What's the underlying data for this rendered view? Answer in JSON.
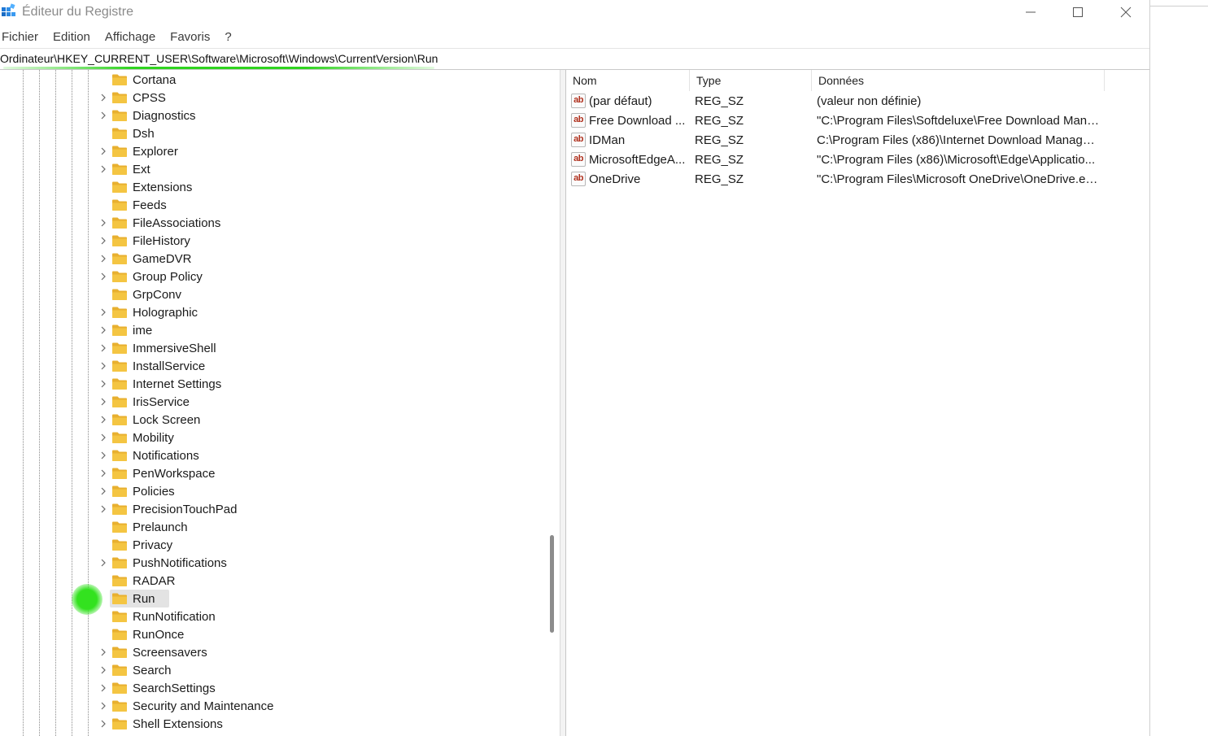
{
  "window": {
    "title": "Éditeur du Registre"
  },
  "menu": [
    {
      "label": "Fichier"
    },
    {
      "label": "Edition"
    },
    {
      "label": "Affichage"
    },
    {
      "label": "Favoris"
    },
    {
      "label": "?"
    }
  ],
  "address": {
    "path": "Ordinateur\\HKEY_CURRENT_USER\\Software\\Microsoft\\Windows\\CurrentVersion\\Run"
  },
  "tree": {
    "items": [
      {
        "label": "Cortana",
        "expandable": false
      },
      {
        "label": "CPSS",
        "expandable": true
      },
      {
        "label": "Diagnostics",
        "expandable": true
      },
      {
        "label": "Dsh",
        "expandable": false
      },
      {
        "label": "Explorer",
        "expandable": true
      },
      {
        "label": "Ext",
        "expandable": true
      },
      {
        "label": "Extensions",
        "expandable": false
      },
      {
        "label": "Feeds",
        "expandable": false
      },
      {
        "label": "FileAssociations",
        "expandable": true
      },
      {
        "label": "FileHistory",
        "expandable": true
      },
      {
        "label": "GameDVR",
        "expandable": true
      },
      {
        "label": "Group Policy",
        "expandable": true
      },
      {
        "label": "GrpConv",
        "expandable": false
      },
      {
        "label": "Holographic",
        "expandable": true
      },
      {
        "label": "ime",
        "expandable": true
      },
      {
        "label": "ImmersiveShell",
        "expandable": true
      },
      {
        "label": "InstallService",
        "expandable": true
      },
      {
        "label": "Internet Settings",
        "expandable": true
      },
      {
        "label": "IrisService",
        "expandable": true
      },
      {
        "label": "Lock Screen",
        "expandable": true
      },
      {
        "label": "Mobility",
        "expandable": true
      },
      {
        "label": "Notifications",
        "expandable": true
      },
      {
        "label": "PenWorkspace",
        "expandable": true
      },
      {
        "label": "Policies",
        "expandable": true
      },
      {
        "label": "PrecisionTouchPad",
        "expandable": true
      },
      {
        "label": "Prelaunch",
        "expandable": false
      },
      {
        "label": "Privacy",
        "expandable": false
      },
      {
        "label": "PushNotifications",
        "expandable": true
      },
      {
        "label": "RADAR",
        "expandable": false
      },
      {
        "label": "Run",
        "expandable": false,
        "selected": true
      },
      {
        "label": "RunNotification",
        "expandable": false
      },
      {
        "label": "RunOnce",
        "expandable": false
      },
      {
        "label": "Screensavers",
        "expandable": true
      },
      {
        "label": "Search",
        "expandable": true
      },
      {
        "label": "SearchSettings",
        "expandable": true
      },
      {
        "label": "Security and Maintenance",
        "expandable": true
      },
      {
        "label": "Shell Extensions",
        "expandable": true
      }
    ]
  },
  "list": {
    "columns": {
      "name": "Nom",
      "type": "Type",
      "data": "Données"
    },
    "rows": [
      {
        "name": "(par défaut)",
        "type": "REG_SZ",
        "data": "(valeur non définie)"
      },
      {
        "name": "Free Download ...",
        "type": "REG_SZ",
        "data": "\"C:\\Program Files\\Softdeluxe\\Free Download Mana..."
      },
      {
        "name": "IDMan",
        "type": "REG_SZ",
        "data": "C:\\Program Files (x86)\\Internet Download Manager..."
      },
      {
        "name": "MicrosoftEdgeA...",
        "type": "REG_SZ",
        "data": "\"C:\\Program Files (x86)\\Microsoft\\Edge\\Applicatio..."
      },
      {
        "name": "OneDrive",
        "type": "REG_SZ",
        "data": "\"C:\\Program Files\\Microsoft OneDrive\\OneDrive.ex..."
      }
    ],
    "value_icon_text": "ab"
  },
  "colors": {
    "folder": "#f4c542",
    "selection": "#e3e3e3",
    "highlight_green": "#2fd31f",
    "value_icon_red": "#b0311e"
  }
}
